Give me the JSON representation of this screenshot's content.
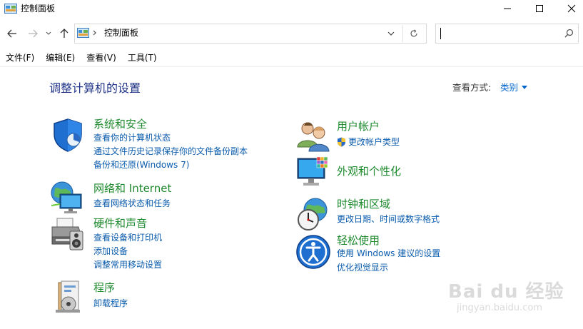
{
  "window": {
    "title": "控制面板"
  },
  "address_bar": {
    "path": "控制面板",
    "search_placeholder": ""
  },
  "menu": {
    "items": [
      "文件(F)",
      "编辑(E)",
      "查看(V)",
      "工具(T)"
    ]
  },
  "main": {
    "heading": "调整计算机的设置",
    "view_by_label": "查看方式:",
    "view_by_value": "类别"
  },
  "categories": {
    "security": {
      "title": "系统和安全",
      "links": [
        "查看你的计算机状态",
        "通过文件历史记录保存你的文件备份副本",
        "备份和还原(Windows 7)"
      ]
    },
    "network": {
      "title": "网络和 Internet",
      "links": [
        "查看网络状态和任务"
      ]
    },
    "hardware": {
      "title": "硬件和声音",
      "links": [
        "查看设备和打印机",
        "添加设备",
        "调整常用移动设置"
      ]
    },
    "programs": {
      "title": "程序",
      "links": [
        "卸载程序"
      ]
    },
    "users": {
      "title": "用户帐户",
      "links": [
        "更改帐户类型"
      ]
    },
    "appearance": {
      "title": "外观和个性化",
      "links": []
    },
    "clock": {
      "title": "时钟和区域",
      "links": [
        "更改日期、时间或数字格式"
      ]
    },
    "ease": {
      "title": "轻松使用",
      "links": [
        "使用 Windows 建议的设置",
        "优化视觉显示"
      ]
    }
  },
  "watermark": {
    "brand": "Bai du 经验",
    "url": "jingyan.baidu.com"
  },
  "colors": {
    "heading_blue": "#1e3287",
    "category_green": "#1e8a2e",
    "link_blue": "#0b5cad"
  }
}
